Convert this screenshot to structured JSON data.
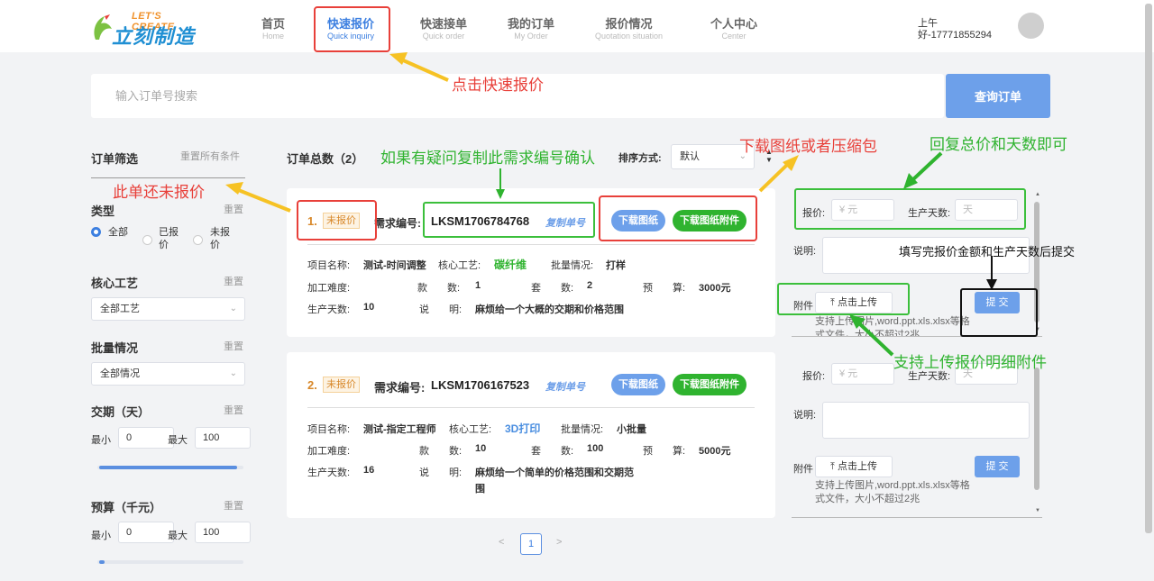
{
  "header": {
    "logo": {
      "tagline": "LET'S CREATE",
      "name": "立刻制造"
    },
    "nav": [
      {
        "cn": "首页",
        "en": "Home"
      },
      {
        "cn": "快速报价",
        "en": "Quick inquiry"
      },
      {
        "cn": "快速接单",
        "en": "Quick order"
      },
      {
        "cn": "我的订单",
        "en": "My Order"
      },
      {
        "cn": "报价情况",
        "en": "Quotation situation"
      },
      {
        "cn": "个人中心",
        "en": "Center"
      }
    ],
    "greeting": "上午好-17771855294"
  },
  "search": {
    "placeholder": "输入订单号搜索",
    "button": "查询订单"
  },
  "filter": {
    "title": "订单筛选",
    "reset_all": "重置所有条件",
    "reset": "重置",
    "type": {
      "label": "类型",
      "options": [
        "全部",
        "已报价",
        "未报价"
      ],
      "selected": "全部"
    },
    "process": {
      "label": "核心工艺",
      "value": "全部工艺"
    },
    "batch": {
      "label": "批量情况",
      "value": "全部情况"
    },
    "delivery": {
      "label": "交期（天）",
      "min_label": "最小",
      "max_label": "最大",
      "min": "0",
      "max": "100"
    },
    "budget": {
      "label": "预算（千元）",
      "min_label": "最小",
      "max_label": "最大",
      "min": "0",
      "max": "100"
    }
  },
  "orders_header": {
    "total": "订单总数（2）",
    "sort_label": "排序方式:",
    "sort_value": "默认"
  },
  "orders": [
    {
      "index": "1.",
      "status": "未报价",
      "req_label": "需求编号:",
      "code": "LKSM1706784768",
      "copy": "复制单号",
      "btn_drawing": "下载图纸",
      "btn_attach": "下载图纸附件",
      "project_label": "项目名称:",
      "project": "测试-时间调整",
      "process_label": "核心工艺:",
      "process": "碳纤维",
      "batch_label": "批量情况:",
      "batch": "打样",
      "difficulty_label": "加工难度:",
      "kinds_label": "款　　数:",
      "kinds": "1",
      "sets_label": "套　　数:",
      "sets": "2",
      "budget_label": "预　　算:",
      "budget": "3000元",
      "days_label": "生产天数:",
      "days": "10",
      "desc_label": "说　　明:",
      "desc": "麻烦给一个大概的交期和价格范围"
    },
    {
      "index": "2.",
      "status": "未报价",
      "req_label": "需求编号:",
      "code": "LKSM1706167523",
      "copy": "复制单号",
      "btn_drawing": "下载图纸",
      "btn_attach": "下载图纸附件",
      "project_label": "项目名称:",
      "project": "测试-指定工程师",
      "process_label": "核心工艺:",
      "process": "3D打印",
      "batch_label": "批量情况:",
      "batch": "小批量",
      "difficulty_label": "加工难度:",
      "kinds_label": "款　　数:",
      "kinds": "10",
      "sets_label": "套　　数:",
      "sets": "100",
      "budget_label": "预　　算:",
      "budget": "5000元",
      "days_label": "生产天数:",
      "days": "16",
      "desc_label": "说　　明:",
      "desc": "麻烦给一个简单的价格范围和交期范围"
    }
  ],
  "quote": {
    "price_label": "报价:",
    "price_placeholder": "¥ 元",
    "days_label": "生产天数:",
    "days_placeholder": "天",
    "desc_label": "说明:",
    "attach_label": "附件",
    "upload": "点击上传",
    "submit": "提 交",
    "hint": "支持上传图片,word.ppt.xls.xlsx等格式文件，大小不超过2兆",
    "hint_clipped": "支持上传图片,word.ppt.xls.xlsx等格式文件，大小不超过2兆"
  },
  "pagination": {
    "current": "1"
  },
  "annotations": {
    "click_quote": "点击快速报价",
    "not_quoted": "此单还未报价",
    "copy_code": "如果有疑问复制此需求编号确认",
    "download": "下载图纸或者压缩包",
    "reply": "回复总价和天数即可",
    "fill_submit": "填写完报价金额和生产天数后提交",
    "upload_support": "支持上传报价明细附件"
  },
  "colors": {
    "accent": "#3c7fe0",
    "button_blue": "#6da0ea",
    "green": "#2fb32f",
    "annotation_red": "#e8403a",
    "annotation_yellow": "#f6c224"
  }
}
